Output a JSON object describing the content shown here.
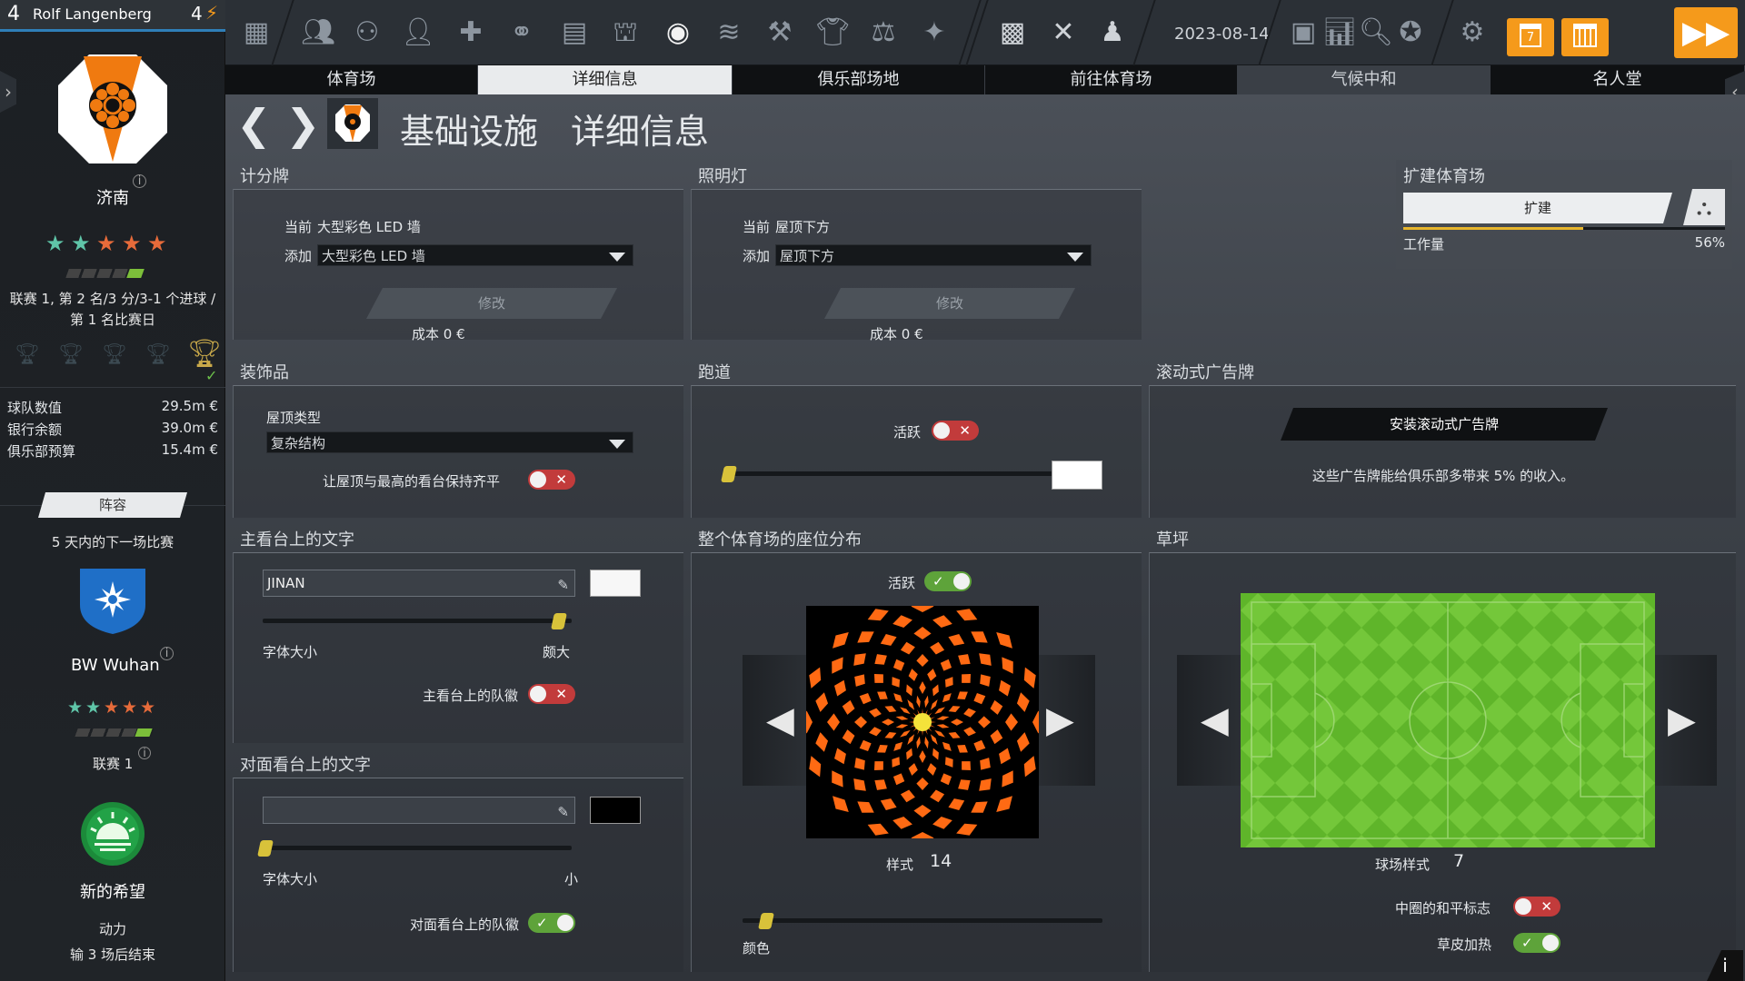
{
  "manager": {
    "number": "4",
    "name": "Rolf Langenberg",
    "alerts": "4"
  },
  "club": {
    "name": "济南",
    "rating_stars": 5,
    "filled_stars": 2,
    "form_text": "联赛 1, 第 2 名/3 分/3-1 个进球 / 第 1 名比赛日",
    "finances": [
      {
        "label": "球队数值",
        "value": "29.5m €"
      },
      {
        "label": "银行余额",
        "value": "39.0m €"
      },
      {
        "label": "俱乐部预算",
        "value": "15.4m €"
      }
    ],
    "lineup_button": "阵容",
    "next_match_label": "5 天内的下一场比赛",
    "opponent": "BW Wuhan",
    "opponent_league": "联赛 1",
    "mood_title": "新的希望",
    "momentum_label": "动力",
    "momentum_text": "输 3 场后结束"
  },
  "topbar": {
    "date": "2023-08-14",
    "calendar_day": "7"
  },
  "tabs": [
    "体育场",
    "详细信息",
    "俱乐部场地",
    "前往体育场",
    "气候中和",
    "名人堂"
  ],
  "active_tab": 1,
  "page": {
    "title_a": "基础设施",
    "title_b": "详细信息"
  },
  "scoreboard": {
    "title": "计分牌",
    "current_label": "当前",
    "current_value": "大型彩色 LED 墙",
    "add_label": "添加",
    "add_value": "大型彩色 LED 墙",
    "modify": "修改",
    "cost": "成本  0 €"
  },
  "lighting": {
    "title": "照明灯",
    "current_label": "当前",
    "current_value": "屋顶下方",
    "add_label": "添加",
    "add_value": "屋顶下方",
    "modify": "修改",
    "cost": "成本  0 €"
  },
  "expand": {
    "title": "扩建体育场",
    "button": "扩建",
    "workload_label": "工作量",
    "workload_value": "56%",
    "workload_fraction": 0.56
  },
  "decor": {
    "title": "装饰品",
    "roof_type_label": "屋顶类型",
    "roof_type_value": "复杂结构",
    "align_label": "让屋顶与最高的看台保持齐平",
    "align_on": false
  },
  "track": {
    "title": "跑道",
    "active_label": "活跃",
    "active_on": false,
    "slider_fraction": 0.0,
    "color": "#ffffff"
  },
  "ads": {
    "title": "滚动式广告牌",
    "button": "安装滚动式广告牌",
    "description": "这些广告牌能给俱乐部多带来 5% 的收入。"
  },
  "main_stand": {
    "title": "主看台上的文字",
    "text_value": "JINAN",
    "color": "#f7f7f7",
    "font_size_label": "字体大小",
    "font_size_value": "颇大",
    "slider_fraction": 0.98,
    "crest_label": "主看台上的队徽",
    "crest_on": false
  },
  "opposite_stand": {
    "title": "对面看台上的文字",
    "text_value": "",
    "color": "#000000",
    "font_size_label": "字体大小",
    "font_size_value": "小",
    "slider_fraction": 0.0,
    "crest_label": "对面看台上的队徽",
    "crest_on": true
  },
  "seating": {
    "title": "整个体育场的座位分布",
    "active_label": "活跃",
    "active_on": true,
    "style_label": "样式",
    "style_value": "14",
    "color_label": "颜色",
    "color_fraction": 0.05
  },
  "pitch": {
    "title": "草坪",
    "style_label": "球场样式",
    "style_value": "7",
    "peace_label": "中圈的和平标志",
    "peace_on": false,
    "heating_label": "草皮加热",
    "heating_on": true
  },
  "colors": {
    "accent": "#f59a1b",
    "toggle_on": "#5ea33a",
    "toggle_off": "#c23b3b",
    "slider_thumb": "#d8c23a",
    "pitch": "#6bbf2f",
    "seat_orange": "#ff6a13"
  }
}
